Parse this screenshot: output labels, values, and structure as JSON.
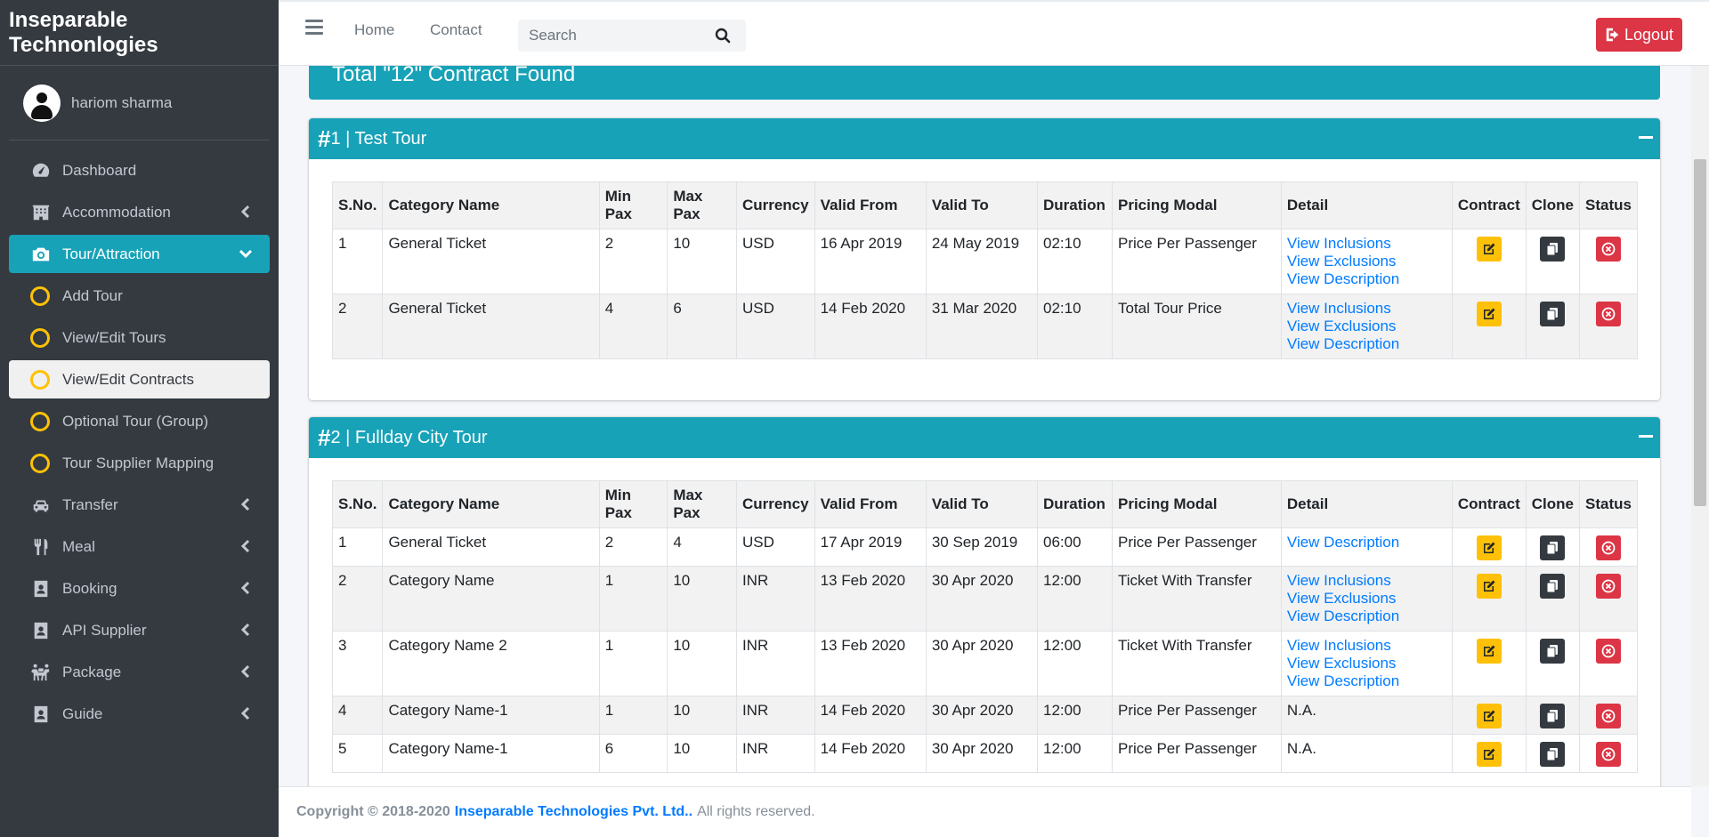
{
  "brand": "Inseparable Technonlogies",
  "user": {
    "name": "hariom sharma"
  },
  "sidebar": {
    "items": [
      {
        "label": "Dashboard"
      },
      {
        "label": "Accommodation"
      },
      {
        "label": "Tour/Attraction"
      },
      {
        "label": "Add Tour"
      },
      {
        "label": "View/Edit Tours"
      },
      {
        "label": "View/Edit Contracts"
      },
      {
        "label": "Optional Tour (Group)"
      },
      {
        "label": "Tour Supplier Mapping"
      },
      {
        "label": "Transfer"
      },
      {
        "label": "Meal"
      },
      {
        "label": "Booking"
      },
      {
        "label": "API Supplier"
      },
      {
        "label": "Package"
      },
      {
        "label": "Guide"
      }
    ]
  },
  "topbar": {
    "home": "Home",
    "contact": "Contact",
    "search_placeholder": "Search",
    "logout": "Logout"
  },
  "summary": {
    "text": "Total \"12\" Contract Found"
  },
  "table_headers": [
    "S.No.",
    "Category Name",
    "Min Pax",
    "Max Pax",
    "Currency",
    "Valid From",
    "Valid To",
    "Duration",
    "Pricing Modal",
    "Detail",
    "Contract",
    "Clone",
    "Status"
  ],
  "tours": [
    {
      "hash": "#",
      "title": "1 | Test Tour",
      "rows": [
        {
          "sno": "1",
          "category": "General Ticket",
          "min": "2",
          "max": "10",
          "currency": "USD",
          "from": "16 Apr 2019",
          "to": "24 May 2019",
          "duration": "02:10",
          "pricing": "Price Per Passenger",
          "details": [
            "View Inclusions",
            "View Exclusions",
            "View Description"
          ]
        },
        {
          "sno": "2",
          "category": "General Ticket",
          "min": "4",
          "max": "6",
          "currency": "USD",
          "from": "14 Feb 2020",
          "to": "31 Mar 2020",
          "duration": "02:10",
          "pricing": "Total Tour Price",
          "details": [
            "View Inclusions",
            "View Exclusions",
            "View Description"
          ]
        }
      ]
    },
    {
      "hash": "#",
      "title": "2 | Fullday City Tour",
      "rows": [
        {
          "sno": "1",
          "category": "General Ticket",
          "min": "2",
          "max": "4",
          "currency": "USD",
          "from": "17 Apr 2019",
          "to": "30 Sep 2019",
          "duration": "06:00",
          "pricing": "Price Per Passenger",
          "details": [
            "View Description"
          ]
        },
        {
          "sno": "2",
          "category": "Category Name",
          "min": "1",
          "max": "10",
          "currency": "INR",
          "from": "13 Feb 2020",
          "to": "30 Apr 2020",
          "duration": "12:00",
          "pricing": "Ticket With Transfer",
          "details": [
            "View Inclusions",
            "View Exclusions",
            "View Description"
          ]
        },
        {
          "sno": "3",
          "category": "Category Name 2",
          "min": "1",
          "max": "10",
          "currency": "INR",
          "from": "13 Feb 2020",
          "to": "30 Apr 2020",
          "duration": "12:00",
          "pricing": "Ticket With Transfer",
          "details": [
            "View Inclusions",
            "View Exclusions",
            "View Description"
          ]
        },
        {
          "sno": "4",
          "category": "Category Name-1",
          "min": "1",
          "max": "10",
          "currency": "INR",
          "from": "14 Feb 2020",
          "to": "30 Apr 2020",
          "duration": "12:00",
          "pricing": "Price Per Passenger",
          "na": "N.A."
        },
        {
          "sno": "5",
          "category": "Category Name-1",
          "min": "6",
          "max": "10",
          "currency": "INR",
          "from": "14 Feb 2020",
          "to": "30 Apr 2020",
          "duration": "12:00",
          "pricing": "Price Per Passenger",
          "na": "N.A."
        }
      ]
    }
  ],
  "footer": {
    "copyright": "Copyright © 2018-2020",
    "company": "Inseparable Technologies Pvt. Ltd..",
    "rest": "All rights reserved."
  }
}
